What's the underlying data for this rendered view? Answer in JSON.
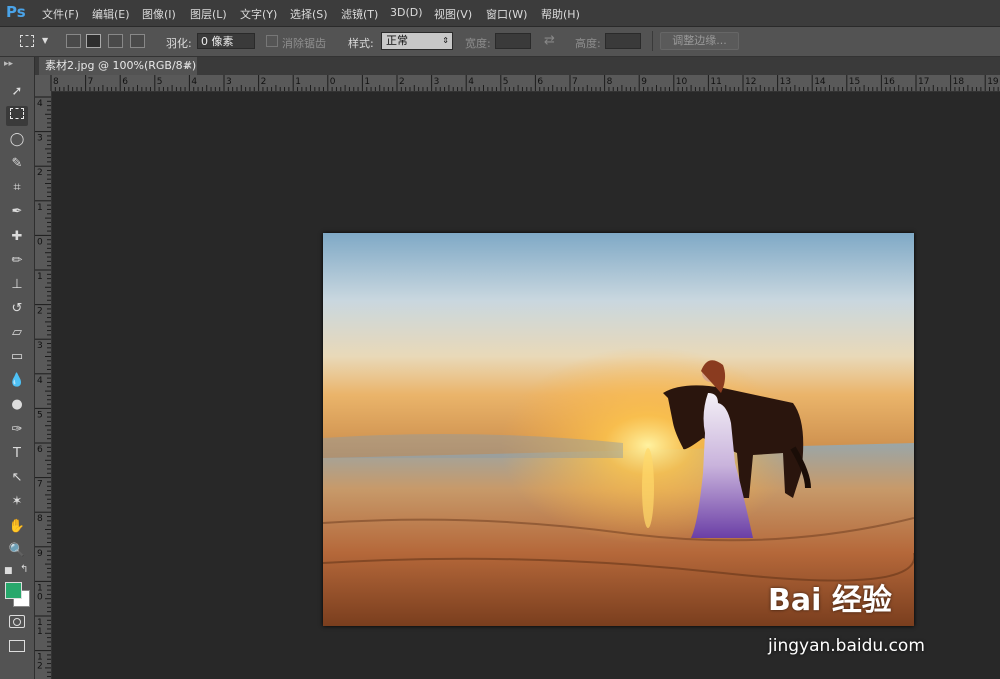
{
  "app": {
    "logo": "Ps"
  },
  "menu": [
    "文件(F)",
    "编辑(E)",
    "图像(I)",
    "图层(L)",
    "文字(Y)",
    "选择(S)",
    "滤镜(T)",
    "3D(D)",
    "视图(V)",
    "窗口(W)",
    "帮助(H)"
  ],
  "options": {
    "feather_label": "羽化:",
    "feather_value": "0 像素",
    "antialias_label": "消除锯齿",
    "style_label": "样式:",
    "style_value": "正常",
    "width_label": "宽度:",
    "height_label": "高度:",
    "refine_edge_button": "调整边缘..."
  },
  "document": {
    "tab_title": "素材2.jpg @ 100%(RGB/8#)",
    "close": "×"
  },
  "ruler": {
    "h_labels": [
      "8",
      "7",
      "6",
      "5",
      "4",
      "3",
      "2",
      "1",
      "0",
      "1",
      "2",
      "3",
      "4",
      "5",
      "6",
      "7",
      "8",
      "9",
      "10",
      "11",
      "12",
      "13",
      "14",
      "15",
      "16",
      "17",
      "18",
      "19"
    ],
    "v_labels": [
      "4",
      "3",
      "2",
      "1",
      "0",
      "1",
      "2",
      "3",
      "4",
      "5",
      "6",
      "7",
      "8",
      "9",
      "1 0",
      "1 1",
      "1 2"
    ]
  },
  "colors": {
    "foreground": "#28a86c",
    "background": "#ffffff",
    "app_bg": "#282828",
    "panel": "#535353"
  },
  "tools": [
    "move-icon",
    "marquee-icon",
    "lasso-icon",
    "quick-select-icon",
    "crop-icon",
    "eyedropper-icon",
    "healing-icon",
    "brush-icon",
    "stamp-icon",
    "history-brush-icon",
    "eraser-icon",
    "gradient-icon",
    "blur-icon",
    "dodge-icon",
    "pen-icon",
    "type-icon",
    "path-select-icon",
    "shape-icon",
    "hand-icon",
    "zoom-icon"
  ],
  "watermark": {
    "logo": "Bai 经验",
    "url": "jingyan.baidu.com"
  }
}
